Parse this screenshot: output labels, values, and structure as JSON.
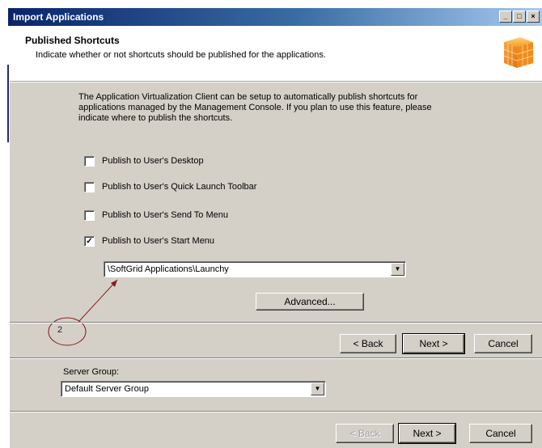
{
  "window": {
    "title": "Import Applications",
    "buttons": [
      "minimize",
      "maximize",
      "close"
    ]
  },
  "header": {
    "heading": "Published Shortcuts",
    "subtitle": "Indicate whether or not shortcuts should be published for the applications."
  },
  "intro_text": "The Application Virtualization Client can be setup to automatically publish shortcuts for applications managed by the Management Console.  If you plan to use this feature, please indicate where to publish the shortcuts.",
  "options": [
    {
      "label": "Publish to User's Desktop",
      "checked": false
    },
    {
      "label": "Publish to User's Quick Launch Toolbar",
      "checked": false
    },
    {
      "label": "Publish to User's Send To Menu",
      "checked": false
    },
    {
      "label": "Publish to User's Start Menu",
      "checked": true
    }
  ],
  "start_menu_path": {
    "value": "\\SoftGrid Applications\\Launchy"
  },
  "advanced_button": "Advanced...",
  "annotation": {
    "label": "2"
  },
  "inner_nav": {
    "back": "< Back",
    "next": "Next >",
    "cancel": "Cancel"
  },
  "server_group": {
    "label": "Server Group:",
    "value": "Default Server Group"
  },
  "outer_nav": {
    "back": "< Back",
    "next": "Next >",
    "cancel": "Cancel",
    "back_enabled": false
  },
  "colors": {
    "title_bar": "#0a246a",
    "dialog_face": "#d4d0c8",
    "annotation": "#8b1a1a"
  }
}
